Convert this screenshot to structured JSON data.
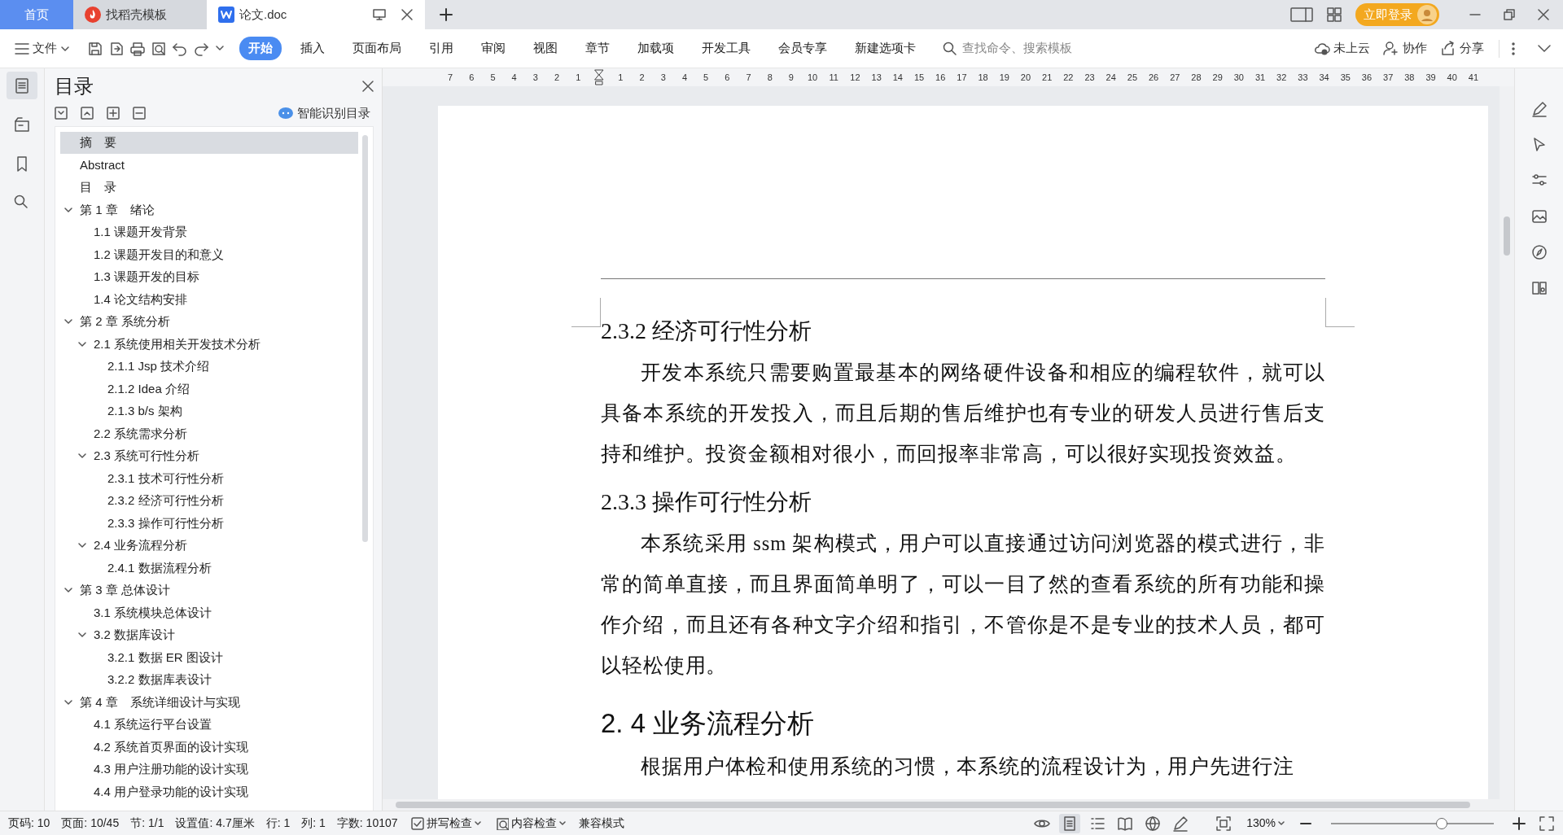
{
  "tabs": [
    {
      "label": "首页",
      "selected": false,
      "kind": "home"
    },
    {
      "label": "找稻壳模板",
      "selected": false,
      "kind": "template"
    },
    {
      "label": "论文.doc",
      "selected": true,
      "kind": "document"
    }
  ],
  "account": {
    "login": "立即登录"
  },
  "toolbar": {
    "file_menu": "文件",
    "ribbon_tabs": [
      {
        "label": "开始",
        "selected": true
      },
      {
        "label": "插入",
        "selected": false
      },
      {
        "label": "页面布局",
        "selected": false
      },
      {
        "label": "引用",
        "selected": false
      },
      {
        "label": "审阅",
        "selected": false
      },
      {
        "label": "视图",
        "selected": false
      },
      {
        "label": "章节",
        "selected": false
      },
      {
        "label": "加载项",
        "selected": false
      },
      {
        "label": "开发工具",
        "selected": false
      },
      {
        "label": "会员专享",
        "selected": false
      },
      {
        "label": "新建选项卡",
        "selected": false
      }
    ],
    "search": {
      "placeholder": "查找命令、搜索模板"
    },
    "actions": [
      {
        "label": "未上云",
        "kind": "cloud"
      },
      {
        "label": "协作",
        "kind": "collab"
      },
      {
        "label": "分享",
        "kind": "share"
      }
    ]
  },
  "toc": {
    "title": "目录",
    "smart_button": "智能识别目录",
    "items": [
      {
        "text": "摘　要",
        "selected": true
      },
      {
        "text": "Abstract",
        "selected": false
      },
      {
        "text": "目　录",
        "selected": false
      },
      {
        "text": "第 1 章　绪论",
        "selected": false,
        "expanded": true,
        "children": [
          {
            "text": "1.1 课题开发背景",
            "selected": false
          },
          {
            "text": "1.2 课题开发目的和意义",
            "selected": false
          },
          {
            "text": "1.3 课题开发的目标",
            "selected": false
          },
          {
            "text": "1.4 论文结构安排",
            "selected": false
          }
        ]
      },
      {
        "text": "第 2 章 系统分析",
        "selected": false,
        "expanded": true,
        "children": [
          {
            "text": "2.1 系统使用相关开发技术分析",
            "selected": false,
            "expanded": true,
            "children": [
              {
                "text": "2.1.1 Jsp 技术介绍",
                "selected": false
              },
              {
                "text": "2.1.2 Idea 介绍",
                "selected": false
              },
              {
                "text": "2.1.3 b/s 架构",
                "selected": false
              }
            ]
          },
          {
            "text": "2.2 系统需求分析",
            "selected": false
          },
          {
            "text": "2.3 系统可行性分析",
            "selected": false,
            "expanded": true,
            "children": [
              {
                "text": "2.3.1 技术可行性分析",
                "selected": false
              },
              {
                "text": "2.3.2 经济可行性分析",
                "selected": false
              },
              {
                "text": "2.3.3  操作可行性分析",
                "selected": false
              }
            ]
          },
          {
            "text": "2.4 业务流程分析",
            "selected": false,
            "expanded": true,
            "children": [
              {
                "text": "2.4.1 数据流程分析",
                "selected": false
              }
            ]
          }
        ]
      },
      {
        "text": "第 3 章 总体设计",
        "selected": false,
        "expanded": true,
        "children": [
          {
            "text": "3.1 系统模块总体设计",
            "selected": false
          },
          {
            "text": "3.2 数据库设计",
            "selected": false,
            "expanded": true,
            "children": [
              {
                "text": "3.2.1 数据 ER 图设计",
                "selected": false
              },
              {
                "text": "3.2.2 数据库表设计",
                "selected": false
              }
            ]
          }
        ]
      },
      {
        "text": "第 4 章　系统详细设计与实现",
        "selected": false,
        "expanded": true,
        "children": [
          {
            "text": "4.1 系统运行平台设置",
            "selected": false
          },
          {
            "text": "4.2 系统首页界面的设计实现",
            "selected": false
          },
          {
            "text": "4.3 用户注册功能的设计实现",
            "selected": false
          },
          {
            "text": "4.4 用户登录功能的设计实现",
            "selected": false
          }
        ]
      }
    ]
  },
  "ruler": {
    "left_marks": [
      "7",
      "6",
      "5",
      "4",
      "3",
      "2",
      "1"
    ],
    "right_marks": [
      "1",
      "2",
      "3",
      "4",
      "5",
      "6",
      "7",
      "8",
      "9",
      "10",
      "11",
      "12",
      "13",
      "14",
      "15",
      "16",
      "17",
      "18",
      "19",
      "20",
      "21",
      "22",
      "23",
      "24",
      "25",
      "26",
      "27",
      "28",
      "29",
      "30",
      "31",
      "32",
      "33",
      "34",
      "35",
      "36",
      "37",
      "38",
      "39",
      "40",
      "41"
    ]
  },
  "document": {
    "blocks": [
      {
        "kind": "heading3",
        "text": "2.3.2 经济可行性分析"
      },
      {
        "kind": "paragraph",
        "text": "开发本系统只需要购置最基本的网络硬件设备和相应的编程软件，就可以具备本系统的开发投入，而且后期的售后维护也有专业的研发人员进行售后支持和维护。投资金额相对很小，而回报率非常高，可以很好实现投资效益。"
      },
      {
        "kind": "heading3",
        "text": "2.3.3  操作可行性分析"
      },
      {
        "kind": "paragraph",
        "text": "本系统采用 ssm 架构模式，用户可以直接通过访问浏览器的模式进行，非常的简单直接，而且界面简单明了，可以一目了然的查看系统的所有功能和操作介绍，而且还有各种文字介绍和指引，不管你是不是专业的技术人员，都可以轻松使用。"
      },
      {
        "kind": "heading2",
        "text": "2. 4 业务流程分析"
      },
      {
        "kind": "paragraph",
        "text": "根据用户体检和使用系统的习惯，本系统的流程设计为，用户先进行注"
      }
    ]
  },
  "status_bar": {
    "items": [
      "页码: 10",
      "页面: 10/45",
      "节: 1/1",
      "设置值: 4.7厘米",
      "行: 1",
      "列: 1",
      "字数: 10107"
    ],
    "spell_check": "拼写检查",
    "content_check": "内容检查",
    "mode": "兼容模式",
    "views": [
      {
        "kind": "eye",
        "selected": false
      },
      {
        "kind": "page",
        "selected": true
      },
      {
        "kind": "outline",
        "selected": false
      },
      {
        "kind": "read",
        "selected": false
      },
      {
        "kind": "web",
        "selected": false
      },
      {
        "kind": "pen",
        "selected": false
      }
    ],
    "zoom": "130%",
    "zoom_slider": {
      "level": 0.68
    }
  }
}
